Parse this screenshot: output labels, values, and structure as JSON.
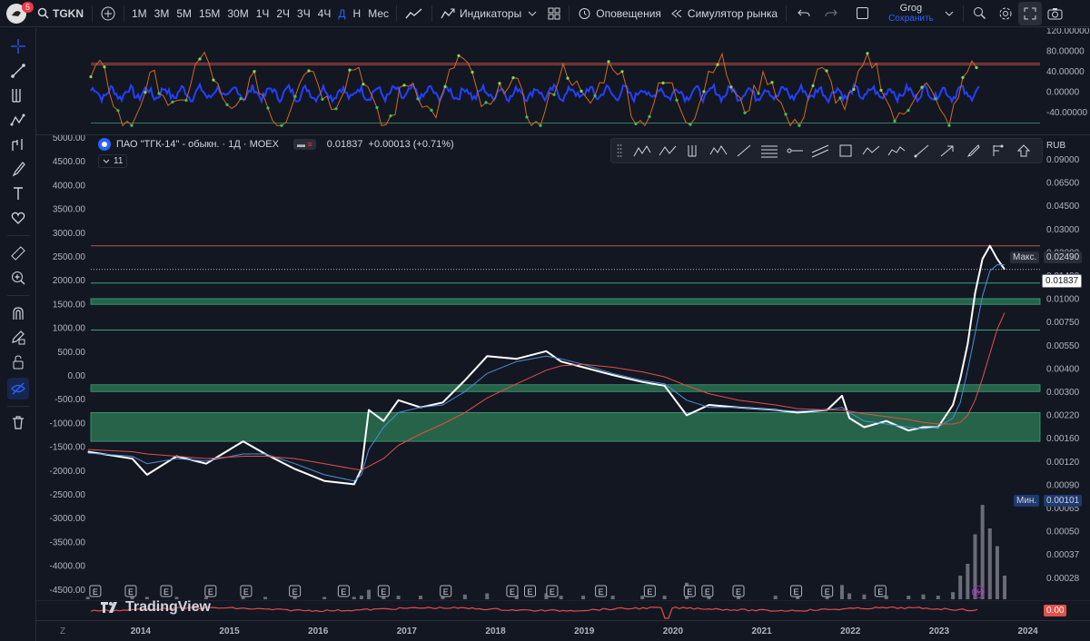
{
  "header": {
    "notification_count": "5",
    "symbol": "TGKN",
    "timeframes": [
      "1М",
      "3М",
      "5М",
      "15М",
      "30М",
      "1Ч",
      "2Ч",
      "3Ч",
      "4Ч",
      "Д",
      "Н",
      "Мес"
    ],
    "active_timeframe": "Д",
    "indicators_label": "Индикаторы",
    "alerts_label": "Оповещения",
    "replay_label": "Симулятор рынка",
    "layout_name": "Grog",
    "save_label": "Сохранить"
  },
  "legend": {
    "title": "ПАО \"ТГК-14\" - обыкн. · 1Д · MOEX",
    "price": "0.01837",
    "change": "+0.00013 (+0.71%)",
    "collapsed_count": "11"
  },
  "currency": "RUB",
  "brand": "TradingView",
  "colors": {
    "background": "#131722",
    "price_line": "#ffffff",
    "ma_fast": "#4a90d9",
    "ma_slow": "#e0504a",
    "zone_fill": "#2e7d57",
    "accent": "#2962ff"
  },
  "oscillator": {
    "axis_labels": [
      "120.00000",
      "80.00000",
      "40.00000",
      "0.00000",
      "-40.00000"
    ],
    "overbought": 60,
    "oversold": -60
  },
  "left_axis_labels": [
    "5000.00",
    "4500.00",
    "4000.00",
    "3500.00",
    "3000.00",
    "2500.00",
    "2000.00",
    "1500.00",
    "1000.00",
    "500.00",
    "0.00",
    "-500.00",
    "-1000.00",
    "-1500.00",
    "-2000.00",
    "-2500.00",
    "-3000.00",
    "-3500.00",
    "-4000.00",
    "-4500.00"
  ],
  "right_axis_labels": [
    "0.09000",
    "0.06500",
    "0.04500",
    "0.03000",
    "0.02000",
    "0.01400",
    "0.01000",
    "0.00750",
    "0.00550",
    "0.00400",
    "0.00300",
    "0.00220",
    "0.00160",
    "0.00120",
    "0.00090",
    "0.00065",
    "0.00050",
    "0.00037",
    "0.00028"
  ],
  "price_markers": {
    "max_label": "Макс.",
    "max_value": "0.02490",
    "current_value": "0.01837",
    "min_label": "Мин.",
    "min_value": "0.00101"
  },
  "bottom_panel_value": "0.00",
  "time_axis": [
    "2014",
    "2015",
    "2016",
    "2017",
    "2018",
    "2019",
    "2020",
    "2021",
    "2022",
    "2023",
    "2024"
  ],
  "earnings_marker": "E",
  "chart_data": {
    "type": "line",
    "scale": "log",
    "currency": "RUB",
    "x": [
      "2013-06",
      "2013-12",
      "2014-02",
      "2014-06",
      "2014-10",
      "2015-03",
      "2015-06",
      "2015-10",
      "2016-02",
      "2016-06",
      "2016-07",
      "2016-08",
      "2016-10",
      "2016-12",
      "2017-03",
      "2017-06",
      "2017-09",
      "2017-12",
      "2018-04",
      "2018-08",
      "2018-10",
      "2019-01",
      "2019-05",
      "2019-09",
      "2019-12",
      "2020-03",
      "2020-06",
      "2020-10",
      "2021-03",
      "2021-06",
      "2021-10",
      "2021-12",
      "2022-01",
      "2022-03",
      "2022-06",
      "2022-09",
      "2022-11",
      "2023-01",
      "2023-03",
      "2023-04",
      "2023-05",
      "2023-06",
      "2023-07",
      "2023-08",
      "2023-09",
      "2023-10"
    ],
    "series": [
      {
        "values": [
          0.00175,
          0.0016,
          0.0013,
          0.00165,
          0.0015,
          0.002,
          0.0017,
          0.0014,
          0.0012,
          0.00115,
          0.0014,
          0.003,
          0.0026,
          0.0034,
          0.0031,
          0.0033,
          0.0044,
          0.006,
          0.0058,
          0.0064,
          0.0056,
          0.0052,
          0.0047,
          0.0043,
          0.0041,
          0.0028,
          0.0032,
          0.0031,
          0.003,
          0.0029,
          0.003,
          0.0036,
          0.0027,
          0.0024,
          0.0026,
          0.0023,
          0.0024,
          0.0024,
          0.0032,
          0.0045,
          0.007,
          0.0135,
          0.021,
          0.0249,
          0.021,
          0.01837
        ]
      },
      {
        "values": [
          0.00172,
          0.00165,
          0.0015,
          0.0016,
          0.00155,
          0.0017,
          0.0017,
          0.0015,
          0.0013,
          0.0012,
          0.0013,
          0.0018,
          0.0024,
          0.0029,
          0.0031,
          0.0032,
          0.0038,
          0.0048,
          0.0056,
          0.006,
          0.0058,
          0.0054,
          0.0048,
          0.0044,
          0.0042,
          0.0034,
          0.0031,
          0.0031,
          0.003,
          0.00295,
          0.003,
          0.0031,
          0.0029,
          0.0026,
          0.0025,
          0.0024,
          0.00235,
          0.0024,
          0.0027,
          0.0033,
          0.005,
          0.008,
          0.013,
          0.018,
          0.0195,
          0.0195
        ]
      },
      {
        "values": [
          0.0018,
          0.00175,
          0.0017,
          0.00165,
          0.0016,
          0.00165,
          0.00165,
          0.0016,
          0.0015,
          0.0014,
          0.00138,
          0.00145,
          0.0016,
          0.0019,
          0.0022,
          0.0025,
          0.0029,
          0.0035,
          0.0042,
          0.005,
          0.0053,
          0.0054,
          0.0052,
          0.0049,
          0.0046,
          0.0041,
          0.0037,
          0.0034,
          0.0032,
          0.00305,
          0.003,
          0.003,
          0.00295,
          0.00285,
          0.00275,
          0.00265,
          0.00255,
          0.0025,
          0.0025,
          0.00255,
          0.0028,
          0.0034,
          0.0045,
          0.0062,
          0.0085,
          0.0105
        ]
      }
    ],
    "horizontal_levels": [
      0.0249,
      0.0154,
      0.0084
    ],
    "zones": [
      [
        0.0117,
        0.0126
      ],
      [
        0.0038,
        0.00415
      ],
      [
        0.002,
        0.0029
      ]
    ],
    "volume": [
      0.02,
      0.02,
      0.02,
      0.02,
      0.02,
      0.03,
      0.02,
      0.02,
      0.02,
      0.02,
      0.03,
      0.08,
      0.04,
      0.03,
      0.03,
      0.03,
      0.04,
      0.05,
      0.04,
      0.05,
      0.03,
      0.03,
      0.03,
      0.03,
      0.03,
      0.14,
      0.04,
      0.03,
      0.03,
      0.03,
      0.05,
      0.12,
      0.05,
      0.04,
      0.03,
      0.03,
      0.04,
      0.03,
      0.06,
      0.2,
      0.3,
      0.55,
      0.8,
      0.6,
      0.45,
      0.2
    ]
  }
}
